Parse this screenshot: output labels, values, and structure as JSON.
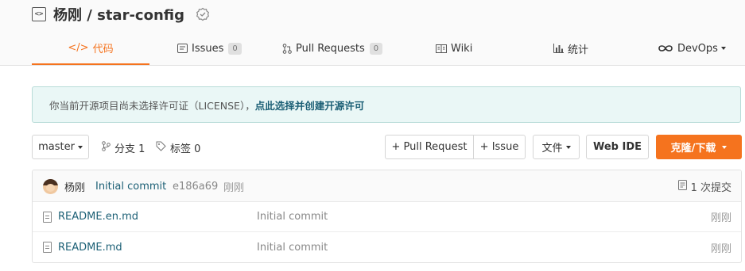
{
  "repo": {
    "title": "杨刚 / star-config",
    "icon": "repo-code-icon",
    "badge_icon": "certified-badge-icon"
  },
  "tabs": [
    {
      "label": "代码",
      "icon": "code-icon",
      "active": true
    },
    {
      "label": "Issues",
      "icon": "issues-icon",
      "count": "0"
    },
    {
      "label": "Pull Requests",
      "icon": "pull-request-icon",
      "count": "0"
    },
    {
      "label": "Wiki",
      "icon": "book-icon"
    },
    {
      "label": "统计",
      "icon": "bar-chart-icon"
    },
    {
      "label": "DevOps",
      "icon": "infinity-icon"
    }
  ],
  "notice": {
    "text": "你当前开源项目尚未选择许可证（LICENSE），",
    "link": "点此选择并创建开源许可"
  },
  "toolbar": {
    "branch": "master",
    "branches": "分支 1",
    "tags": "标签 0",
    "pull_request": "+ Pull Request",
    "issue": "+ Issue",
    "files": "文件",
    "web_ide": "Web IDE",
    "clone": "克隆/下载"
  },
  "latest_commit": {
    "author": "杨刚",
    "message": "Initial commit",
    "hash": "e186a69",
    "time": "刚刚",
    "count": "1 次提交"
  },
  "files": [
    {
      "name": "README.en.md",
      "message": "Initial commit",
      "time": "刚刚"
    },
    {
      "name": "README.md",
      "message": "Initial commit",
      "time": "刚刚"
    }
  ],
  "colors": {
    "accent": "#f5731e",
    "link": "#1b5f75",
    "notice_bg": "#eaf7f6"
  }
}
